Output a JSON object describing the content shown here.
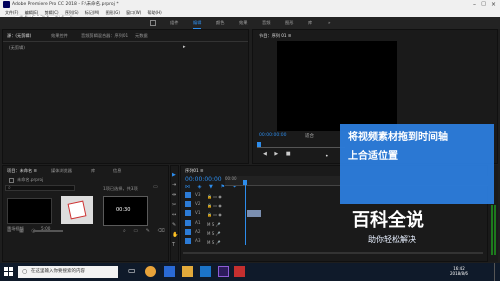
{
  "window": {
    "title": "Adobe Premiere Pro CC 2018 - F:\\未命名.prproj *"
  },
  "watermark": {
    "text": "秒懂视频"
  },
  "menu": [
    "文件(F)",
    "编辑(E)",
    "剪辑(C)",
    "序列(S)",
    "标记(M)",
    "图形(G)",
    "窗口(W)",
    "帮助(H)"
  ],
  "workspaces": [
    "组件",
    "编辑",
    "颜色",
    "效果",
    "音频",
    "图形",
    "库"
  ],
  "source_panel": {
    "tabs": [
      "源：(无剪辑)",
      "效果控件",
      "音频剪辑混合器：序列01",
      "元数据"
    ],
    "empty_label": "(无剪辑)"
  },
  "program_panel": {
    "title": "节目：序列 01 ≡",
    "timecode": "00:00:00:00",
    "fit": "适合",
    "full": "完整",
    "end_timecode": "00:00:03:00"
  },
  "project_panel": {
    "tabs": [
      "项目：未命名 ≡",
      "媒体浏览器",
      "库",
      "信息"
    ],
    "path": "未命名.prproj",
    "count": "1项已选择，共3项",
    "items": [
      {
        "name": "黑场视频",
        "duration": "5:00"
      },
      {
        "name": "",
        "duration": ""
      },
      {
        "name": "",
        "duration": "00:30"
      }
    ]
  },
  "timeline": {
    "title": "序列01 ≡",
    "timecode": "00:00:00:00",
    "ruler_time": "00:00",
    "video_tracks": [
      "V3",
      "V2",
      "V1"
    ],
    "audio_tracks": [
      "A1",
      "A2",
      "A3"
    ]
  },
  "overlay": {
    "line1": "将视频素材拖到时间轴",
    "line2": "上合适位置"
  },
  "brand": {
    "title": "百科全说",
    "subtitle": "助你轻松解决"
  },
  "taskbar": {
    "search_placeholder": "在这里输入你要搜索的内容",
    "time": "16:42",
    "date": "2018/8/6"
  },
  "colors": {
    "accent": "#2d8ceb",
    "overlay": "#2c7cdb",
    "timecode": "#2d8ceb"
  }
}
